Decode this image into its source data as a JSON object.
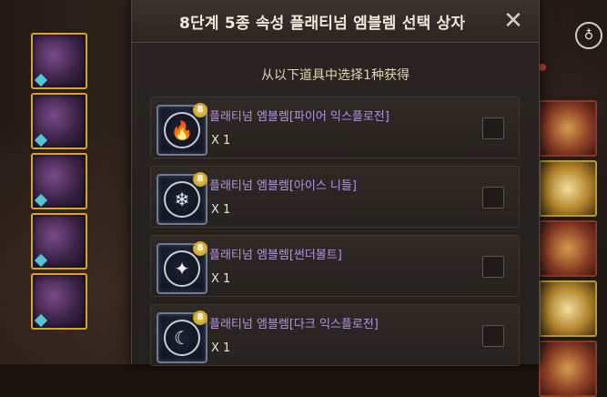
{
  "dialog": {
    "title": "8단계 5종 속성 플래티넘 엠블렘 선택 상자",
    "subtitle": "从以下道具中选择1种获得",
    "close_symbol": "✕"
  },
  "items": [
    {
      "name": "플래티넘 엠블렘[파이어 익스플로전]",
      "qty": "X 1",
      "level_badge": "8",
      "emblem_glyph": "🔥",
      "icon": "fire-emblem-icon"
    },
    {
      "name": "플래티넘 엠블렘[아이스 니들]",
      "qty": "X 1",
      "level_badge": "8",
      "emblem_glyph": "❄",
      "icon": "ice-emblem-icon"
    },
    {
      "name": "플래티넘 엠블렘[썬더볼트]",
      "qty": "X 1",
      "level_badge": "8",
      "emblem_glyph": "✦",
      "icon": "thunder-emblem-icon"
    },
    {
      "name": "플래티넘 엠블렘[다크 익스플로전]",
      "qty": "X 1",
      "level_badge": "8",
      "emblem_glyph": "☾",
      "icon": "dark-emblem-icon"
    }
  ],
  "colors": {
    "item_name": "#b592e6",
    "title": "#ede7dc",
    "subtitle": "#e2d6b2",
    "slot_border_gold": "#d7a52a"
  }
}
